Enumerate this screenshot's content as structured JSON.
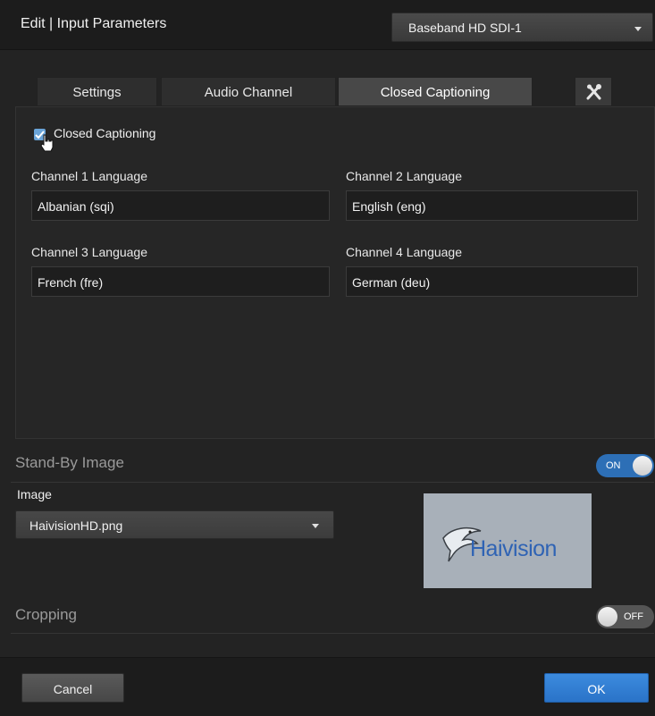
{
  "header": {
    "title": "Edit | Input Parameters",
    "source_select": "Baseband HD SDI-1"
  },
  "tabs": [
    {
      "label": "Settings",
      "active": false
    },
    {
      "label": "Audio Channel",
      "active": false
    },
    {
      "label": "Closed Captioning",
      "active": true
    }
  ],
  "tools_icon": "tools-icon",
  "closed_captioning": {
    "checkbox_label": "Closed Captioning",
    "checked": true,
    "fields": [
      {
        "label": "Channel 1 Language",
        "value": "Albanian (sqi)"
      },
      {
        "label": "Channel 2 Language",
        "value": "English (eng)"
      },
      {
        "label": "Channel 3 Language",
        "value": "French (fre)"
      },
      {
        "label": "Channel 4 Language",
        "value": "German (deu)"
      }
    ]
  },
  "standby": {
    "title": "Stand-By Image",
    "toggle": "ON",
    "image_label": "Image",
    "image_value": "HaivisionHD.png",
    "preview_logo": "Haivision"
  },
  "cropping": {
    "title": "Cropping",
    "toggle": "OFF"
  },
  "footer": {
    "cancel": "Cancel",
    "ok": "OK"
  },
  "colors": {
    "accent": "#2d6fb6",
    "background": "#232323",
    "logo_blue": "#2f63b4"
  }
}
